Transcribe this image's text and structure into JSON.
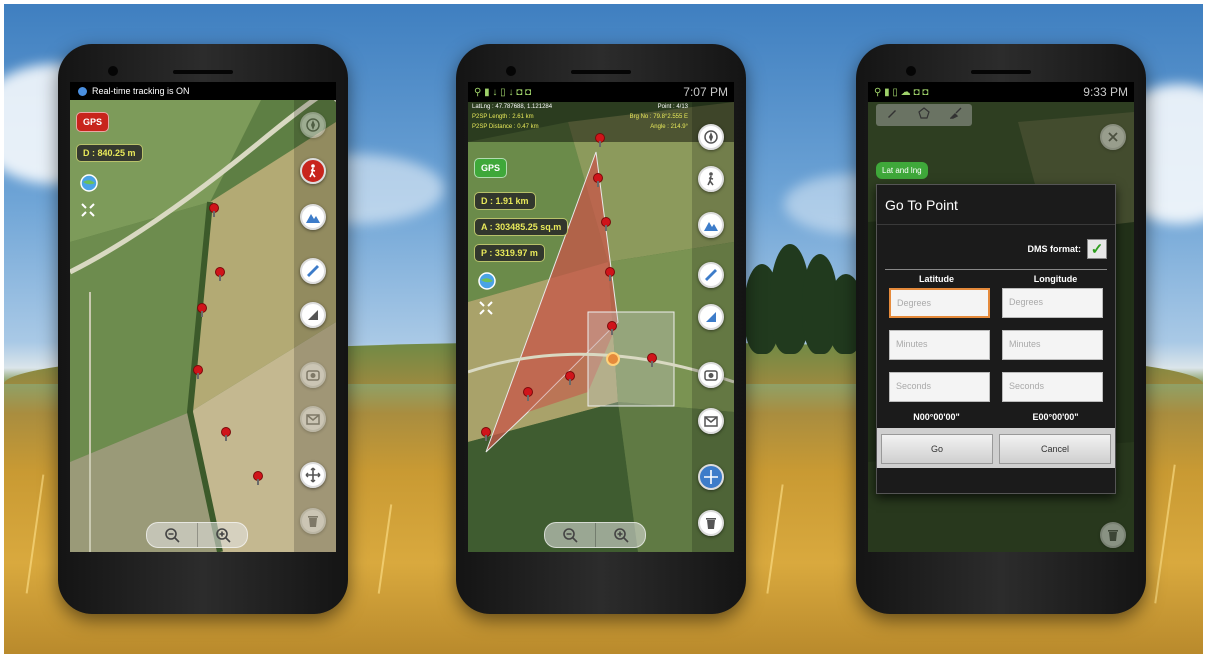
{
  "phone1": {
    "notification": "Real-time tracking is ON",
    "gps_label": "GPS",
    "distance": "D : 840.25 m"
  },
  "phone2": {
    "status_time": "7:07 PM",
    "latlng_line": "LatLng : 47.787688, 1.121284",
    "point_line": "Point : 4/13",
    "length_line": "P2SP Length : 2.61 km",
    "bearing_line": "Brg No : 79.8°2.555 E",
    "distance_line": "P2SP Distance : 0.47 km",
    "angle_line": "Angle : 214.9°",
    "gps_label": "GPS",
    "distance": "D : 1.91 km",
    "area": "A : 303485.25 sq.m",
    "perimeter": "P : 3319.97 m"
  },
  "phone3": {
    "status_time": "9:33 PM",
    "latlng_tab": "Lat and lng",
    "dialog": {
      "title": "Go To Point",
      "dms_label": "DMS format:",
      "latitude_header": "Latitude",
      "longitude_header": "Longitude",
      "degrees_placeholder": "Degrees",
      "minutes_placeholder": "Minutes",
      "seconds_placeholder": "Seconds",
      "lat_readout": "N00°00'00\"",
      "lng_readout": "E00°00'00\"",
      "go_label": "Go",
      "cancel_label": "Cancel"
    }
  },
  "colors": {
    "gps_red": "#c8241c",
    "gps_green": "#3fa83a",
    "info_text": "#e8e95a",
    "area_fill": "#c8564a",
    "accent_orange": "#e58a3b"
  },
  "icons": [
    "compass-icon",
    "walker-icon",
    "mountain-icon",
    "ruler-icon",
    "cone-icon",
    "camera-icon",
    "mail-icon",
    "move-icon",
    "trash-icon",
    "zoom-out-icon",
    "zoom-in-icon",
    "globe-icon",
    "fullscreen-icon"
  ]
}
